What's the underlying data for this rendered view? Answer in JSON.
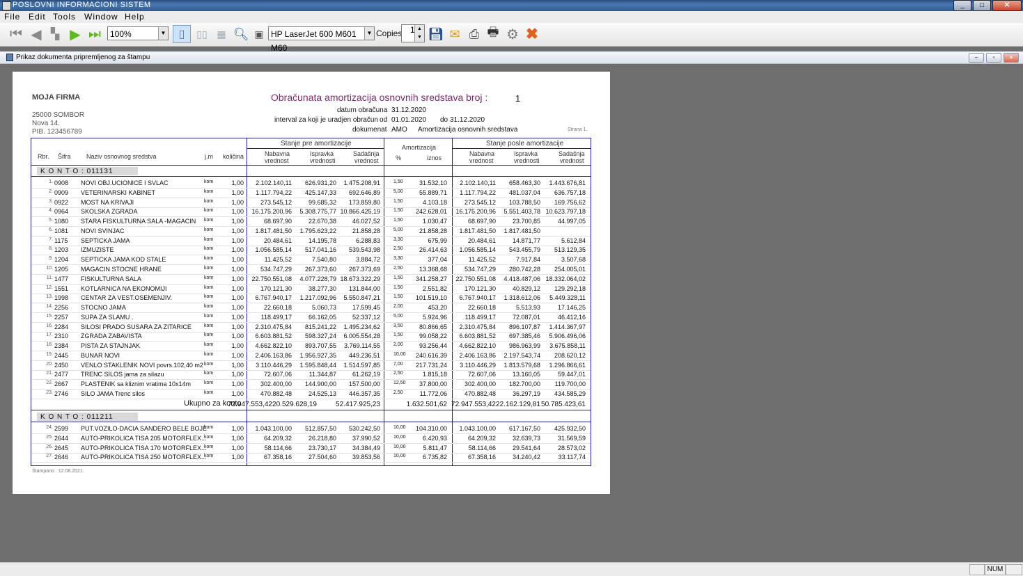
{
  "window": {
    "title": "POSLOVNI INFORMACIONI SISTEM",
    "btn_min": "_",
    "btn_max": "□",
    "btn_close": "✕"
  },
  "menu": {
    "file": "File",
    "edit": "Edit",
    "tools": "Tools",
    "window": "Window",
    "help": "Help"
  },
  "toolbar": {
    "zoom": "100%",
    "printer": "HP LaserJet 600 M601 M60",
    "copies_label": "Copies",
    "copies_value": "1"
  },
  "doc_window": {
    "title": "Prikaz dokumenta pripremljenog za štampu"
  },
  "status": {
    "num": "NUM"
  },
  "report": {
    "company": "MOJA FIRMA",
    "city": "25000 SOMBOR",
    "street": "Nova 14.",
    "pib": "PIB.  123456789",
    "title": "Obračunata amortizacija osnovnih sredstava broj :",
    "number": "1",
    "datum_label": "datum obračuna",
    "datum_value": "31.12.2020",
    "interval_label": "interval za koji je uradjen obračun",
    "od_label": "od",
    "od_value": "01.01.2020",
    "do_label": "do",
    "do_value": "31.12.2020",
    "dokument_label": "dokumenat",
    "dokument_code": "AMO",
    "dokument_name": "Amortizacija osnovnih sredstava",
    "strana": "Strana   1.",
    "footer": "Štampano : 12.08.2021.",
    "headers": {
      "rbr": "Rbr.",
      "sifra": "Šifra",
      "naziv": "Naziv osnovnog sredstva",
      "jm": "j.m",
      "kolicina": "količina",
      "pre": "Stanje pre amortizacije",
      "nabavna": "Nabavna",
      "ispravka": "Ispravka",
      "sadasnja": "Sadašnja",
      "vrednost": "vrednost",
      "vrednosti": "vrednosti",
      "amortizacija": "Amortizacija",
      "pct": "%",
      "iznos": "iznos",
      "posle": "Stanje posle amortizacije"
    },
    "konto1": "K O N T O   :   011131",
    "konto2": "K O N T O   :   011211",
    "total_label": "Ukupno za konto",
    "total": {
      "nab": "72.947.553,42",
      "isp": "20.529.628,19",
      "sad": "52.417.925,23",
      "izn": "1.632.501,62",
      "pnab": "72.947.553,42",
      "pisp": "22.162.129,81",
      "psad": "50.785.423,61"
    },
    "rows1": [
      {
        "rb": "1.",
        "sf": "0908",
        "nz": "NOVI OBJ.UCIONICE I SVLAC",
        "jm": "kom",
        "kol": "1,00",
        "nab": "2.102.140,11",
        "isp": "626.931,20",
        "sad": "1.475.208,91",
        "pct": "1,50",
        "izn": "31.532,10",
        "pnab": "2.102.140,11",
        "pisp": "658.463,30",
        "psad": "1.443.676,81"
      },
      {
        "rb": "2.",
        "sf": "0909",
        "nz": "VETERINARSKI KABINET",
        "jm": "kom",
        "kol": "1,00",
        "nab": "1.117.794,22",
        "isp": "425.147,33",
        "sad": "692.646,89",
        "pct": "5,00",
        "izn": "55.889,71",
        "pnab": "1.117.794,22",
        "pisp": "481.037,04",
        "psad": "636.757,18"
      },
      {
        "rb": "3.",
        "sf": "0922",
        "nz": "MOST NA KRIVAJI",
        "jm": "kom",
        "kol": "1,00",
        "nab": "273.545,12",
        "isp": "99.685,32",
        "sad": "173.859,80",
        "pct": "1,50",
        "izn": "4.103,18",
        "pnab": "273.545,12",
        "pisp": "103.788,50",
        "psad": "169.756,62"
      },
      {
        "rb": "4.",
        "sf": "0964",
        "nz": "SKOLSKA ZGRADA",
        "jm": "kom",
        "kol": "1,00",
        "nab": "16.175.200,96",
        "isp": "5.308.775,77",
        "sad": "10.866.425,19",
        "pct": "1,50",
        "izn": "242.628,01",
        "pnab": "16.175.200,96",
        "pisp": "5.551.403,78",
        "psad": "10.623.797,18"
      },
      {
        "rb": "5.",
        "sf": "1080",
        "nz": "STARA FISKULTURNA SALA -MAGACIN",
        "jm": "kom",
        "kol": "1,00",
        "nab": "68.697,90",
        "isp": "22.670,38",
        "sad": "46.027,52",
        "pct": "1,50",
        "izn": "1.030,47",
        "pnab": "68.697,90",
        "pisp": "23.700,85",
        "psad": "44.997,05"
      },
      {
        "rb": "6.",
        "sf": "1081",
        "nz": "NOVI SVINJAC",
        "jm": "kom",
        "kol": "1,00",
        "nab": "1.817.481,50",
        "isp": "1.795.623,22",
        "sad": "21.858,28",
        "pct": "5,00",
        "izn": "21.858,28",
        "pnab": "1.817.481,50",
        "pisp": "1.817.481,50",
        "psad": ""
      },
      {
        "rb": "7.",
        "sf": "1175",
        "nz": "SEPTICKA JAMA",
        "jm": "kom",
        "kol": "1,00",
        "nab": "20.484,61",
        "isp": "14.195,78",
        "sad": "6.288,83",
        "pct": "3,30",
        "izn": "675,99",
        "pnab": "20.484,61",
        "pisp": "14.871,77",
        "psad": "5.612,84"
      },
      {
        "rb": "8.",
        "sf": "1203",
        "nz": "IZMUZISTE",
        "jm": "kom",
        "kol": "1,00",
        "nab": "1.056.585,14",
        "isp": "517.041,16",
        "sad": "539.543,98",
        "pct": "2,50",
        "izn": "26.414,63",
        "pnab": "1.056.585,14",
        "pisp": "543.455,79",
        "psad": "513.129,35"
      },
      {
        "rb": "9.",
        "sf": "1204",
        "nz": "SEPTICKA JAMA KOD STALE",
        "jm": "kom",
        "kol": "1,00",
        "nab": "11.425,52",
        "isp": "7.540,80",
        "sad": "3.884,72",
        "pct": "3,30",
        "izn": "377,04",
        "pnab": "11.425,52",
        "pisp": "7.917,84",
        "psad": "3.507,68"
      },
      {
        "rb": "10.",
        "sf": "1205",
        "nz": "MAGACIN STOCNE HRANE",
        "jm": "kom",
        "kol": "1,00",
        "nab": "534.747,29",
        "isp": "267.373,60",
        "sad": "267.373,69",
        "pct": "2,50",
        "izn": "13.368,68",
        "pnab": "534.747,29",
        "pisp": "280.742,28",
        "psad": "254.005,01"
      },
      {
        "rb": "11.",
        "sf": "1477",
        "nz": "FISKULTURNA SALA",
        "jm": "kom",
        "kol": "1,00",
        "nab": "22.750.551,08",
        "isp": "4.077.228,79",
        "sad": "18.673.322,29",
        "pct": "1,50",
        "izn": "341.258,27",
        "pnab": "22.750.551,08",
        "pisp": "4.418.487,06",
        "psad": "18.332.064,02"
      },
      {
        "rb": "12.",
        "sf": "1551",
        "nz": "KOTLARNICA NA EKONOMIJI",
        "jm": "kom",
        "kol": "1,00",
        "nab": "170.121,30",
        "isp": "38.277,30",
        "sad": "131.844,00",
        "pct": "1,50",
        "izn": "2.551,82",
        "pnab": "170.121,30",
        "pisp": "40.829,12",
        "psad": "129.292,18"
      },
      {
        "rb": "13.",
        "sf": "1998",
        "nz": "CENTAR ZA VEST.OSEMENJIV.",
        "jm": "kom",
        "kol": "1,00",
        "nab": "6.767.940,17",
        "isp": "1.217.092,96",
        "sad": "5.550.847,21",
        "pct": "1,50",
        "izn": "101.519,10",
        "pnab": "6.767.940,17",
        "pisp": "1.318.612,06",
        "psad": "5.449.328,11"
      },
      {
        "rb": "14.",
        "sf": "2256",
        "nz": "STOCNO JAMA",
        "jm": "kom",
        "kol": "1,00",
        "nab": "22.660,18",
        "isp": "5.060,73",
        "sad": "17.599,45",
        "pct": "2,00",
        "izn": "453,20",
        "pnab": "22.660,18",
        "pisp": "5.513,93",
        "psad": "17.146,25"
      },
      {
        "rb": "15.",
        "sf": "2257",
        "nz": "SUPA ZA SLAMU .",
        "jm": "kom",
        "kol": "1,00",
        "nab": "118.499,17",
        "isp": "66.162,05",
        "sad": "52.337,12",
        "pct": "5,00",
        "izn": "5.924,96",
        "pnab": "118.499,17",
        "pisp": "72.087,01",
        "psad": "46.412,16"
      },
      {
        "rb": "16.",
        "sf": "2284",
        "nz": "SILOSI PRADO SUSARA ZA ZITARICE",
        "jm": "kom",
        "kol": "1,00",
        "nab": "2.310.475,84",
        "isp": "815.241,22",
        "sad": "1.495.234,62",
        "pct": "3,50",
        "izn": "80.866,65",
        "pnab": "2.310.475,84",
        "pisp": "896.107,87",
        "psad": "1.414.367,97"
      },
      {
        "rb": "17.",
        "sf": "2310",
        "nz": "ZGRADA ZABAVISTA",
        "jm": "kom",
        "kol": "1,00",
        "nab": "6.603.881,52",
        "isp": "598.327,24",
        "sad": "6.005.554,28",
        "pct": "1,50",
        "izn": "99.058,22",
        "pnab": "6.603.881,52",
        "pisp": "697.385,46",
        "psad": "5.906.496,06"
      },
      {
        "rb": "18.",
        "sf": "2384",
        "nz": "PISTA ZA STAJNJAK",
        "jm": "kom",
        "kol": "1,00",
        "nab": "4.662.822,10",
        "isp": "893.707,55",
        "sad": "3.769.114,55",
        "pct": "2,00",
        "izn": "93.256,44",
        "pnab": "4.662.822,10",
        "pisp": "986.963,99",
        "psad": "3.675.858,11"
      },
      {
        "rb": "19.",
        "sf": "2445",
        "nz": "BUNAR NOVI",
        "jm": "kom",
        "kol": "1,00",
        "nab": "2.406.163,86",
        "isp": "1.956.927,35",
        "sad": "449.236,51",
        "pct": "10,00",
        "izn": "240.616,39",
        "pnab": "2.406.163,86",
        "pisp": "2.197.543,74",
        "psad": "208.620,12"
      },
      {
        "rb": "20.",
        "sf": "2450",
        "nz": "VENLO STAKLENIK NOVI povrs.102,40 m2",
        "jm": "kom",
        "kol": "1,00",
        "nab": "3.110.446,29",
        "isp": "1.595.848,44",
        "sad": "1.514.597,85",
        "pct": "7,00",
        "izn": "217.731,24",
        "pnab": "3.110.446,29",
        "pisp": "1.813.579,68",
        "psad": "1.296.866,61"
      },
      {
        "rb": "21.",
        "sf": "2477",
        "nz": "TRENC SILOS jama za silazu",
        "jm": "kom",
        "kol": "1,00",
        "nab": "72.607,06",
        "isp": "11.344,87",
        "sad": "61.262,19",
        "pct": "2,50",
        "izn": "1.815,18",
        "pnab": "72.607,06",
        "pisp": "13.160,05",
        "psad": "59.447,01"
      },
      {
        "rb": "22.",
        "sf": "2667",
        "nz": "PLASTENIK sa kliznim vratima 10x14m",
        "jm": "kom",
        "kol": "1,00",
        "nab": "302.400,00",
        "isp": "144.900,00",
        "sad": "157.500,00",
        "pct": "12,50",
        "izn": "37.800,00",
        "pnab": "302.400,00",
        "pisp": "182.700,00",
        "psad": "119.700,00"
      },
      {
        "rb": "23.",
        "sf": "2746",
        "nz": "SILO JAMA Trenc silos",
        "jm": "kom",
        "kol": "1,00",
        "nab": "470.882,48",
        "isp": "24.525,13",
        "sad": "446.357,35",
        "pct": "2,50",
        "izn": "11.772,06",
        "pnab": "470.882,48",
        "pisp": "36.297,19",
        "psad": "434.585,29"
      }
    ],
    "rows2": [
      {
        "rb": "24.",
        "sf": "2599",
        "nz": "PUT.VOZILO-DACIA SANDERO BELE BOJE",
        "jm": "kom",
        "kol": "1,00",
        "nab": "1.043.100,00",
        "isp": "512.857,50",
        "sad": "530.242,50",
        "pct": "10,00",
        "izn": "104.310,00",
        "pnab": "1.043.100,00",
        "pisp": "617.167,50",
        "psad": "425.932,50"
      },
      {
        "rb": "25.",
        "sf": "2644",
        "nz": "AUTO-PRIKOLICA TISA 205 MOTORFLEX...",
        "jm": "kom",
        "kol": "1,00",
        "nab": "64.209,32",
        "isp": "26.218,80",
        "sad": "37.990,52",
        "pct": "10,00",
        "izn": "6.420,93",
        "pnab": "64.209,32",
        "pisp": "32.639,73",
        "psad": "31.569,59"
      },
      {
        "rb": "26.",
        "sf": "2645",
        "nz": "AUTO-PRIKOLICA TISA 170 MOTORFLEX...",
        "jm": "kom",
        "kol": "1,00",
        "nab": "58.114,66",
        "isp": "23.730,17",
        "sad": "34.384,49",
        "pct": "10,00",
        "izn": "5.811,47",
        "pnab": "58.114,66",
        "pisp": "29.541,64",
        "psad": "28.573,02"
      },
      {
        "rb": "27.",
        "sf": "2646",
        "nz": "AUTO-PRIKOLICA TISA 250 MOTORFLEX...",
        "jm": "kom",
        "kol": "1,00",
        "nab": "67.358,16",
        "isp": "27.504,60",
        "sad": "39.853,56",
        "pct": "10,00",
        "izn": "6.735,82",
        "pnab": "67.358,16",
        "pisp": "34.240,42",
        "psad": "33.117,74"
      }
    ]
  }
}
